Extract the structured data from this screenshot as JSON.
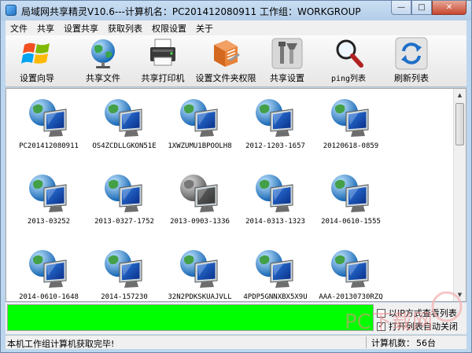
{
  "window": {
    "title": "局域网共享精灵V10.6---计算机名：PC201412080911  工作组：WORKGROUP",
    "controls": {
      "minimize": "—",
      "maximize": "□",
      "close": "✕"
    }
  },
  "menu": [
    "文件",
    "共享",
    "设置共享",
    "获取列表",
    "权限设置",
    "关于"
  ],
  "toolbar": [
    {
      "label": "设置向导",
      "icon": "windows-logo-icon"
    },
    {
      "label": "共享文件",
      "icon": "globe-icon"
    },
    {
      "label": "共享打印机",
      "icon": "printer-icon"
    },
    {
      "label": "设置文件夹权限",
      "icon": "folder-permission-icon"
    },
    {
      "label": "共享设置",
      "icon": "settings-tools-icon"
    },
    {
      "label": "ping列表",
      "icon": "magnifier-icon"
    },
    {
      "label": "刷新列表",
      "icon": "refresh-icon"
    }
  ],
  "computers": [
    {
      "name": "PC201412080911",
      "online": true
    },
    {
      "name": "OS4ZCDLLGKON51E",
      "online": true
    },
    {
      "name": "1XWZUMU1BPOOLH8",
      "online": true
    },
    {
      "name": "2012-1203-1657",
      "online": true
    },
    {
      "name": "20120618-0859",
      "online": true
    },
    {
      "name": "2013-03252",
      "online": true
    },
    {
      "name": "2013-0327-1752",
      "online": true
    },
    {
      "name": "2013-0903-1336",
      "online": false
    },
    {
      "name": "2014-0313-1323",
      "online": true
    },
    {
      "name": "2014-0610-1555",
      "online": true
    },
    {
      "name": "2014-0610-1648",
      "online": true
    },
    {
      "name": "2014-157230",
      "online": true
    },
    {
      "name": "32N2PDKSKUAJVLL",
      "online": true
    },
    {
      "name": "4PDP5GNNXBX5X9U",
      "online": true
    },
    {
      "name": "AAA-20130730RZQ",
      "online": true
    }
  ],
  "progress": {
    "percent": 100,
    "color": "#00ff00"
  },
  "options": {
    "view_by_ip": {
      "label": "以IP方式查看列表",
      "checked": false
    },
    "auto_close": {
      "label": "打开列表自动关闭",
      "checked": true
    }
  },
  "status": {
    "message": "本机工作组计算机获取完毕!",
    "count_label": "计算机数：",
    "count_value": "56台"
  },
  "watermark": {
    "text": "PC下载网"
  }
}
